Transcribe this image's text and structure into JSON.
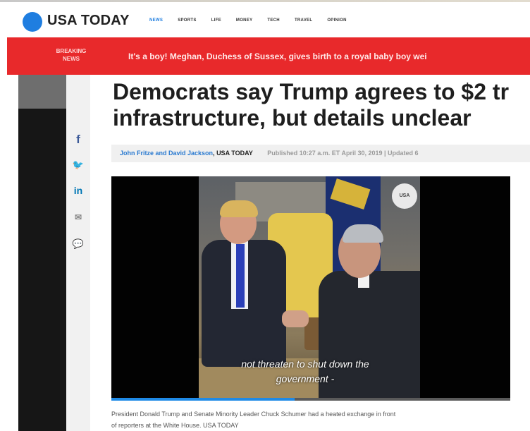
{
  "header": {
    "logo_text": "USA TODAY",
    "nav": [
      "NEWS",
      "SPORTS",
      "LIFE",
      "MONEY",
      "TECH",
      "TRAVEL",
      "OPINION"
    ],
    "active_nav": "NEWS",
    "brand_color": "#1f7ee0"
  },
  "breaking": {
    "label": "BREAKING\nNEWS",
    "text": "It's a boy! Meghan, Duchess of Sussex, gives birth to a royal baby boy wei",
    "color": "#e8292b"
  },
  "share": {
    "icons": [
      "facebook-icon",
      "twitter-icon",
      "linkedin-icon",
      "email-icon",
      "comment-icon"
    ],
    "facebook": "f",
    "twitter": "🐦",
    "linkedin": "in",
    "email": "✉",
    "comment": "💬"
  },
  "article": {
    "headline": "Democrats say Trump agrees to $2 tr\ninfrastructure, but details unclear",
    "authors": "John Fritze and David Jackson",
    "byline_separator": ", ",
    "byline_org": "USA TODAY",
    "published": "Published 10:27 a.m. ET April 30, 2019 | Updated 6"
  },
  "video": {
    "caption": "not threaten to shut down the\ngovernment -",
    "badge": "USA",
    "progress": 0.46
  },
  "figure_caption": "President Donald Trump and Senate Minority Leader Chuck Schumer had a heated exchange in front\nof reporters at the White House. USA TODAY"
}
